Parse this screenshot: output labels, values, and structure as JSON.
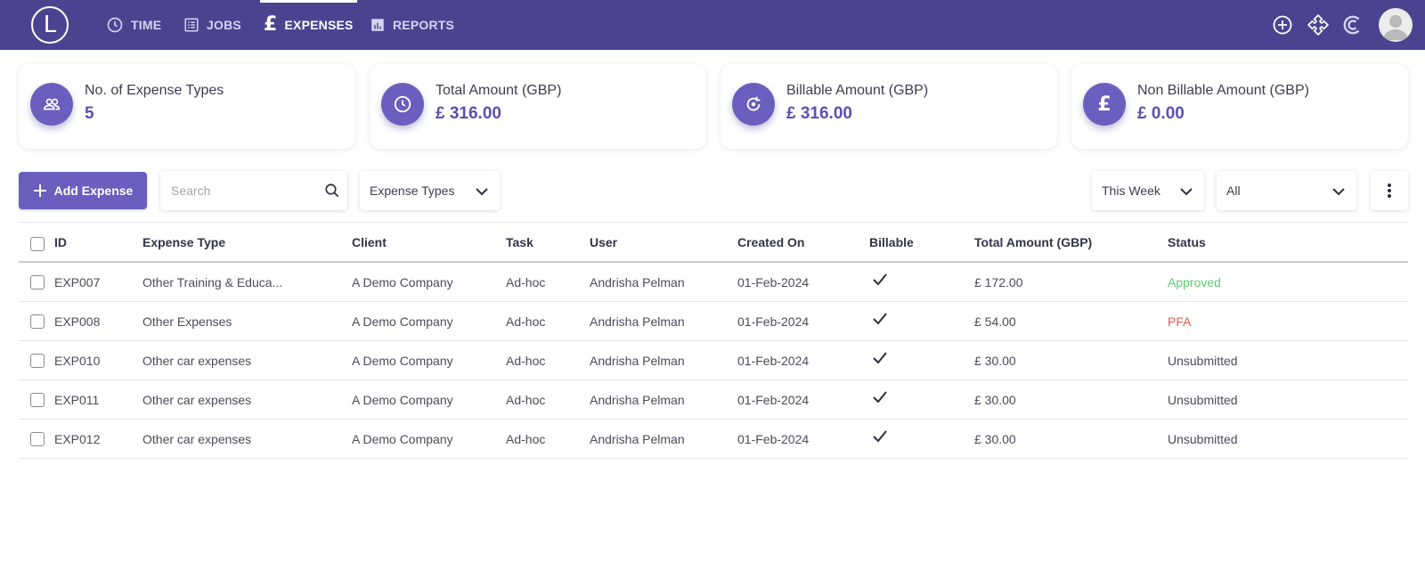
{
  "nav": {
    "logo": "L",
    "items": [
      {
        "label": "TIME",
        "icon": "clock-icon"
      },
      {
        "label": "JOBS",
        "icon": "list-icon"
      },
      {
        "label": "EXPENSES",
        "icon": "pound-icon",
        "active": true
      },
      {
        "label": "REPORTS",
        "icon": "bar-chart-icon"
      }
    ],
    "right_icons": [
      "plus-circle-icon",
      "puzzle-icon",
      "c-logo-icon",
      "avatar"
    ]
  },
  "cards": [
    {
      "label": "No. of Expense Types",
      "value": "5",
      "icon": "users-icon"
    },
    {
      "label": "Total Amount (GBP)",
      "value": "£ 316.00",
      "icon": "clock-icon"
    },
    {
      "label": "Billable Amount (GBP)",
      "value": "£ 316.00",
      "icon": "refresh-icon"
    },
    {
      "label": "Non Billable Amount (GBP)",
      "value": "£ 0.00",
      "icon": "pound-icon"
    }
  ],
  "toolbar": {
    "add_label": "Add Expense",
    "search_placeholder": "Search",
    "expense_types": "Expense Types",
    "period": "This Week",
    "filter": "All"
  },
  "table": {
    "columns": [
      "ID",
      "Expense Type",
      "Client",
      "Task",
      "User",
      "Created On",
      "Billable",
      "Total Amount (GBP)",
      "Status"
    ],
    "rows": [
      {
        "id": "EXP007",
        "type": "Other Training & Educa...",
        "client": "A Demo Company",
        "task": "Ad-hoc",
        "user": "Andrisha Pelman",
        "created": "01-Feb-2024",
        "billable": true,
        "amount": "£ 172.00",
        "status": "Approved"
      },
      {
        "id": "EXP008",
        "type": "Other Expenses",
        "client": "A Demo Company",
        "task": "Ad-hoc",
        "user": "Andrisha Pelman",
        "created": "01-Feb-2024",
        "billable": true,
        "amount": "£ 54.00",
        "status": "PFA"
      },
      {
        "id": "EXP010",
        "type": "Other car expenses",
        "client": "A Demo Company",
        "task": "Ad-hoc",
        "user": "Andrisha Pelman",
        "created": "01-Feb-2024",
        "billable": true,
        "amount": "£ 30.00",
        "status": "Unsubmitted"
      },
      {
        "id": "EXP011",
        "type": "Other car expenses",
        "client": "A Demo Company",
        "task": "Ad-hoc",
        "user": "Andrisha Pelman",
        "created": "01-Feb-2024",
        "billable": true,
        "amount": "£ 30.00",
        "status": "Unsubmitted"
      },
      {
        "id": "EXP012",
        "type": "Other car expenses",
        "client": "A Demo Company",
        "task": "Ad-hoc",
        "user": "Andrisha Pelman",
        "created": "01-Feb-2024",
        "billable": true,
        "amount": "£ 30.00",
        "status": "Unsubmitted"
      }
    ]
  },
  "colors": {
    "nav_bg": "#4a4490",
    "accent": "#6a5fbe",
    "value_text": "#5b50b3",
    "status_approved": "#5ccb70",
    "status_pfa": "#e05a4f"
  }
}
